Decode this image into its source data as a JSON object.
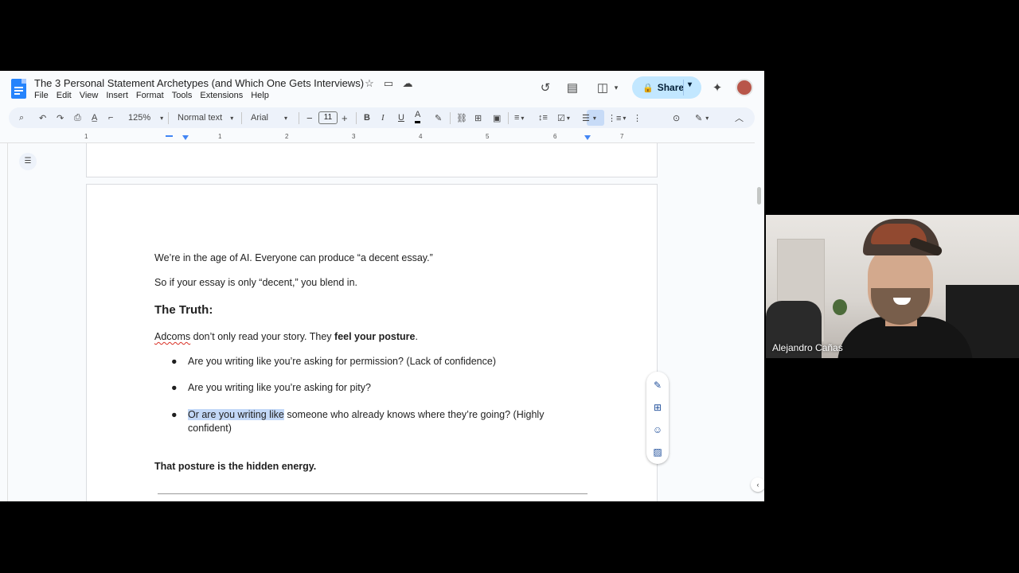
{
  "doc": {
    "title": "The 3 Personal Statement Archetypes (and Which One Gets Interviews)",
    "menu": [
      "File",
      "Edit",
      "View",
      "Insert",
      "Format",
      "Tools",
      "Extensions",
      "Help"
    ],
    "share_label": "Share"
  },
  "toolbar": {
    "zoom": "125%",
    "style": "Normal text",
    "font": "Arial",
    "font_size": "11"
  },
  "ruler": [
    "1",
    "1",
    "2",
    "3",
    "4",
    "5",
    "6",
    "7"
  ],
  "content": {
    "p1": "We’re in the age of AI. Everyone can produce “a decent essay.”",
    "p2": "So if your essay is only “decent,” you blend in.",
    "heading": "The Truth:",
    "p3_word": "Adcoms",
    "p3_rest": " don’t only read your story. They ",
    "p3_bold": "feel your posture",
    "p3_end": ".",
    "bullet_char": "●",
    "b1": "Are you writing like you’re asking for permission? (Lack of confidence)",
    "b2": "Are you writing like you’re asking for pity?",
    "b3_highlight": "Or are you writing like",
    "b3_rest": " someone who already knows where they’re going? (Highly",
    "b3_line2": "confident)",
    "p4": "That posture is the hidden energy."
  },
  "participant": {
    "name": "Alejandro Cañas"
  },
  "colors": {
    "share_bg": "#c2e7ff",
    "highlight": "#c3d8f7",
    "docs_blue": "#2684fc"
  },
  "icons": {
    "title": [
      "star-icon",
      "move-to-folder-icon",
      "cloud-saved-icon"
    ],
    "right": [
      "version-history-icon",
      "comments-icon",
      "meet-icon",
      "gemini-icon"
    ],
    "side_panel": [
      "edit-suggest-icon",
      "add-comment-icon",
      "emoji-reaction-icon",
      "suggest-edits-icon"
    ]
  }
}
